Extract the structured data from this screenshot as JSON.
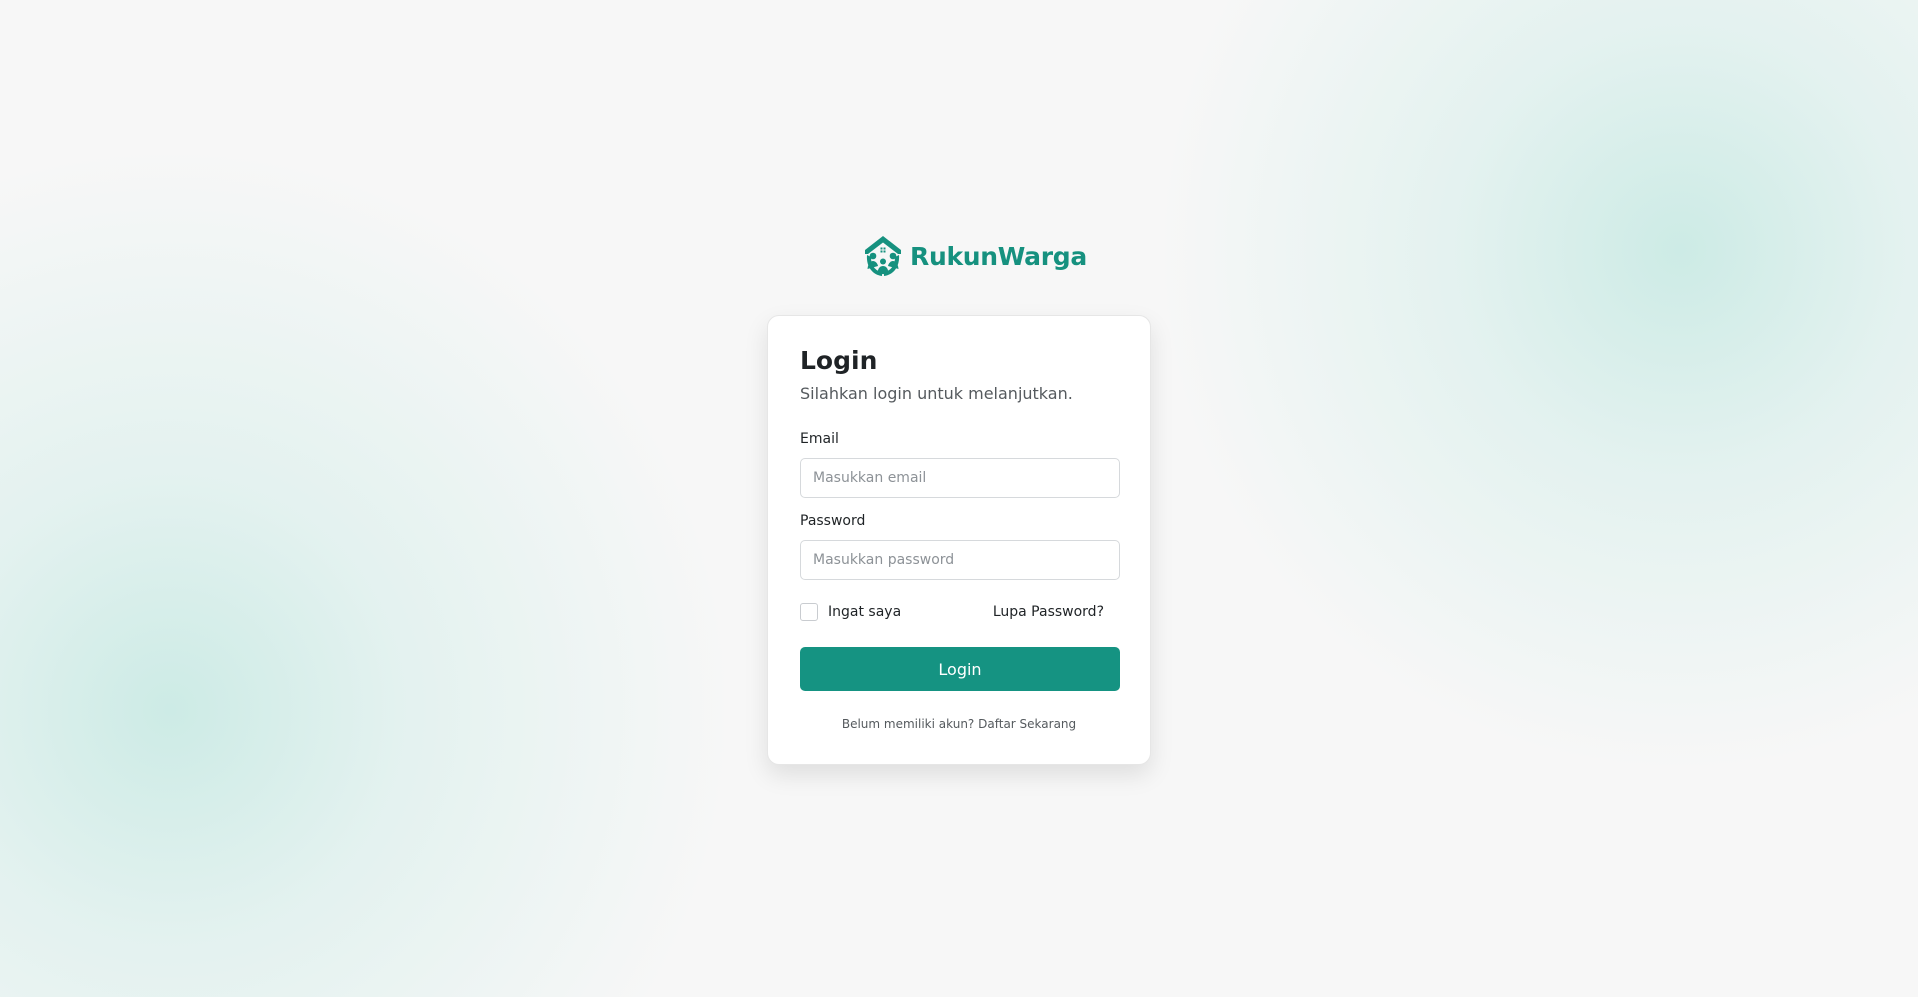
{
  "brand": {
    "name": "RukunWarga",
    "logo_icon": "house-people-icon",
    "color": "#16917f"
  },
  "login_card": {
    "title": "Login",
    "subtitle": "Silahkan login untuk melanjutkan.",
    "email": {
      "label": "Email",
      "placeholder": "Masukkan email",
      "value": ""
    },
    "password": {
      "label": "Password",
      "placeholder": "Masukkan password",
      "value": ""
    },
    "remember_me": {
      "label": "Ingat saya",
      "checked": false
    },
    "forgot_password": "Lupa Password?",
    "submit_label": "Login",
    "register_prompt": "Belum memiliki akun?",
    "register_link": "Daftar Sekarang"
  },
  "colors": {
    "primary": "#159382",
    "background": "#f7f7f7",
    "accent_glow": "#b7e4dc"
  }
}
